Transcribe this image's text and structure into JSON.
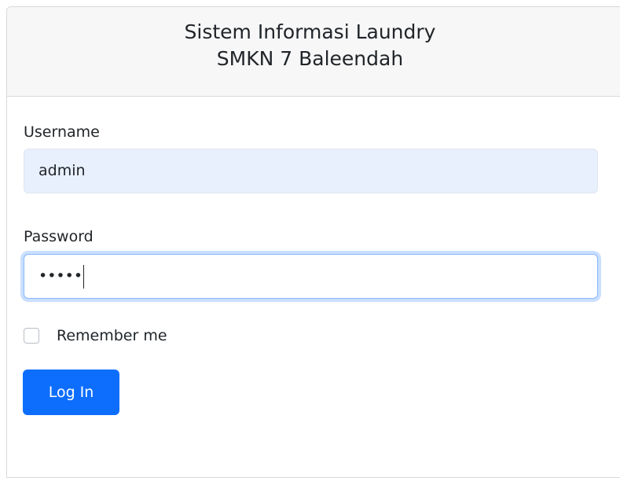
{
  "header": {
    "title_line1": "Sistem Informasi Laundry",
    "title_line2": "SMKN 7 Baleendah"
  },
  "form": {
    "username_label": "Username",
    "username_value": "admin",
    "password_label": "Password",
    "password_value": "•••••",
    "remember_label": "Remember me",
    "remember_checked": false,
    "login_button": "Log In"
  },
  "colors": {
    "primary": "#0d6efd",
    "autofill_bg": "#e8f0fe",
    "header_bg": "#f7f7f7"
  }
}
